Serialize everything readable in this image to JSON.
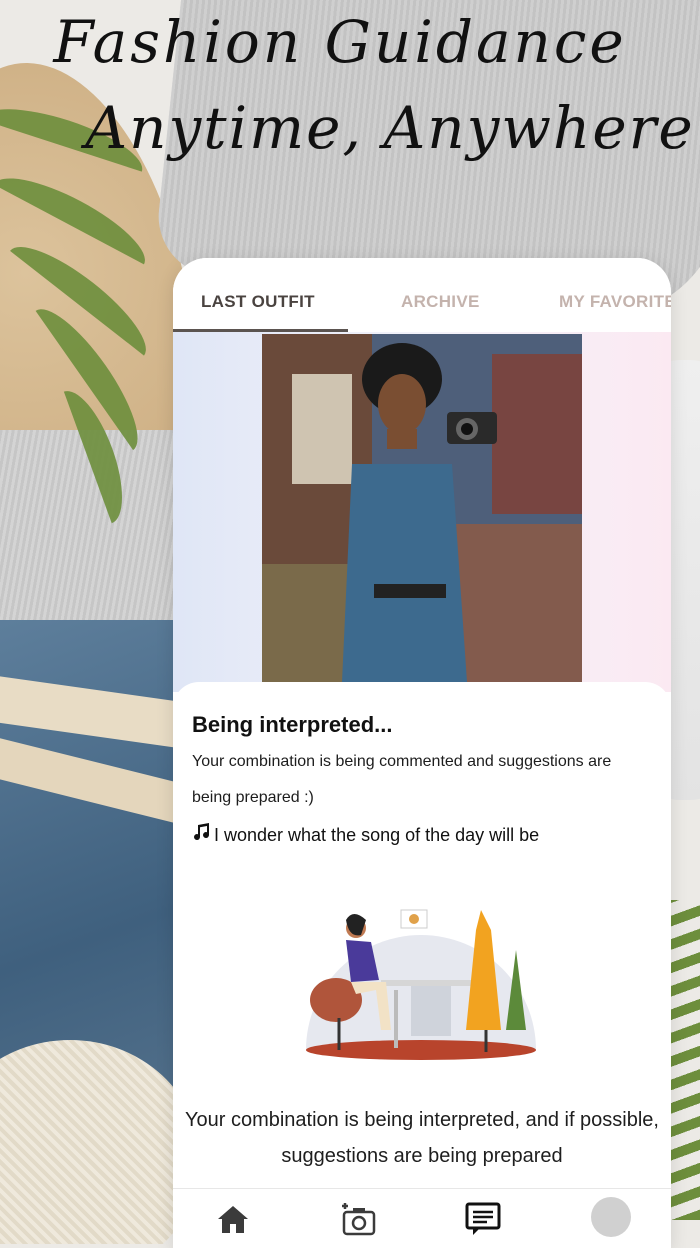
{
  "headline": {
    "line1": "Fashion Guidance",
    "line2": "Anytime, Anywhere"
  },
  "tabs": [
    {
      "label": "LAST OUTFIT",
      "active": true
    },
    {
      "label": "ARCHIVE",
      "active": false
    },
    {
      "label": "MY FAVORITE",
      "active": false
    }
  ],
  "status": {
    "title": "Being interpreted...",
    "subtitle": "Your combination is being commented and suggestions are being prepared :)",
    "song_text": "I wonder what the song of the day will be",
    "song_icon": "music-note-icon",
    "bottom_message": "Your combination is being interpreted, and if possible, suggestions are being prepared"
  },
  "nav": {
    "items": [
      "home-icon",
      "add-photo-icon",
      "chat-icon",
      "avatar"
    ]
  },
  "colors": {
    "tab_active": "#4a4340",
    "tab_inactive": "#c4b3ad",
    "card_bg": "#ffffff"
  }
}
